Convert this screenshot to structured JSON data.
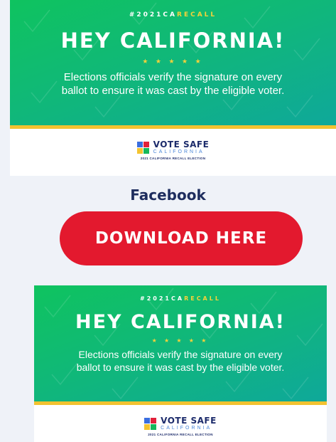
{
  "graphic": {
    "hashtag_prefix": "#2021CA",
    "hashtag_highlight": "RECALL",
    "headline": "HEY CALIFORNIA!",
    "stars": "★ ★ ★ ★ ★",
    "body": "Elections officials verify the signature on every ballot to ensure it was cast by the eligible voter.",
    "logo_title": "VOTE SAFE",
    "logo_subtitle": "CALIFORNIA",
    "logo_caption": "2021 CALIFORNIA RECALL ELECTION"
  },
  "section": {
    "platform_label": "Facebook",
    "download_label": "DOWNLOAD HERE"
  },
  "colors": {
    "green": "#0fc35f",
    "teal": "#0fa89a",
    "yellow": "#f2c230",
    "button_red": "#e3192e",
    "navy": "#1e2d5e",
    "background": "#eff2f8"
  }
}
